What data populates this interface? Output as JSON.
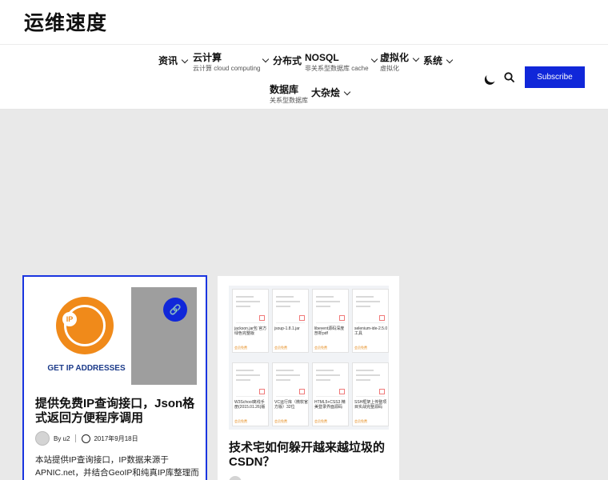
{
  "site": {
    "title": "运维速度"
  },
  "nav": [
    {
      "label": "资讯",
      "sub": ""
    },
    {
      "label": "云计算",
      "sub": "云计算 cloud computing"
    },
    {
      "label": "分布式",
      "sub": ""
    },
    {
      "label": "NOSQL",
      "sub": "非关系型数据库 cache"
    },
    {
      "label": "虚拟化",
      "sub": "虚拟化"
    },
    {
      "label": "系统",
      "sub": ""
    },
    {
      "label": "数据库",
      "sub": "关系型数据库"
    },
    {
      "label": "大杂烩",
      "sub": ""
    }
  ],
  "header_actions": {
    "subscribe_label": "Subscribe",
    "theme_icon": "moon-icon",
    "search_icon": "search-icon"
  },
  "posts": [
    {
      "thumb_text": "GET IP ADDRESSES",
      "thumb_badge": "IP",
      "title": "提供免费IP查询接口，Json格式返回方便程序调用",
      "author": "By u2",
      "date": "2017年9月18日",
      "excerpt": "本站提供IP查询接口，IP数据来源于APNIC.net，并结合GeoIP和纯真IP库整理而"
    },
    {
      "title": "技术宅如何躲开越来越垃圾的CSDN？",
      "docs": [
        {
          "cap": "jackson.jar包 官方绿色完整版",
          "tag": "会员免费"
        },
        {
          "cap": "jsoup-1.8.1.jar",
          "tag": "会员免费"
        },
        {
          "cap": "libevent源码深度剖析pdf",
          "tag": "会员免费"
        },
        {
          "cap": "selenium-ide-2.5.0工具",
          "tag": "会员免费"
        },
        {
          "cap": "W3School离线手册(2015.01.26)版",
          "tag": "会员免费"
        },
        {
          "cap": "VC运行库（微软官方版）32位",
          "tag": "会员免费"
        },
        {
          "cap": "HTML5+CSS3 精美登录界面源码",
          "tag": "会员免费"
        },
        {
          "cap": "SSH框架上传整项目实战完整源码",
          "tag": "会员免费"
        }
      ]
    }
  ]
}
